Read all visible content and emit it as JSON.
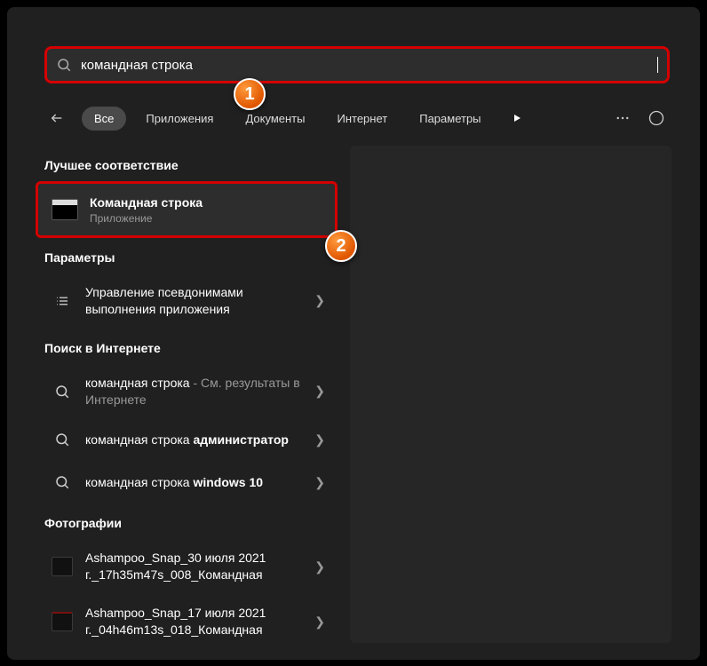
{
  "search": {
    "query": "командная строка"
  },
  "tabs": {
    "items": [
      "Все",
      "Приложения",
      "Документы",
      "Интернет",
      "Параметры"
    ],
    "active_index": 0
  },
  "badges": {
    "one": "1",
    "two": "2"
  },
  "sections": {
    "best_match": "Лучшее соответствие",
    "settings": "Параметры",
    "web": "Поиск в Интернете",
    "photos": "Фотографии"
  },
  "best_match_item": {
    "title": "Командная строка",
    "subtitle": "Приложение"
  },
  "settings_items": [
    {
      "title": "Управление псевдонимами выполнения приложения"
    }
  ],
  "web_items": [
    {
      "pre": "командная строка",
      "post": " - См. результаты в Интернете"
    },
    {
      "pre": "командная строка ",
      "bold": "администратор"
    },
    {
      "pre": "командная строка ",
      "bold": "windows 10"
    }
  ],
  "photo_items": [
    {
      "title": "Ashampoo_Snap_30 июля 2021 г._17h35m47s_008_Командная"
    },
    {
      "title": "Ashampoo_Snap_17 июля 2021 г._04h46m13s_018_Командная"
    }
  ]
}
